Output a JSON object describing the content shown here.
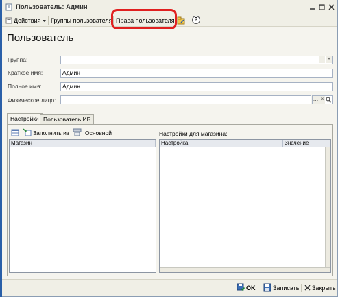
{
  "window": {
    "title": "Пользователь: Админ"
  },
  "toolbar": {
    "actions_label": "Действия",
    "user_groups_label": "Группы пользователя",
    "user_rights_label": "Права пользователя",
    "help_label": "?"
  },
  "form": {
    "title": "Пользователь",
    "group": {
      "label": "Группа:",
      "value": ""
    },
    "short_name": {
      "label": "Краткое имя:",
      "value": "Админ"
    },
    "full_name": {
      "label": "Полное имя:",
      "value": "Админ"
    },
    "person": {
      "label": "Физическое лицо:",
      "value": ""
    }
  },
  "tabs": [
    {
      "label": "Настройки"
    },
    {
      "label": "Пользователь ИБ"
    }
  ],
  "settings": {
    "fill_from_label": "Заполнить из",
    "main_label": "Основной",
    "shops_column": "Магазин",
    "shop_settings_label": "Настройки для магазина:",
    "setting_column": "Настройка",
    "value_column": "Значение"
  },
  "bottom": {
    "ok_label": "OK",
    "save_label": "Записать",
    "close_label": "Закрыть"
  },
  "colors": {
    "highlight": "#e02020",
    "accent": "#2a5fa8"
  }
}
